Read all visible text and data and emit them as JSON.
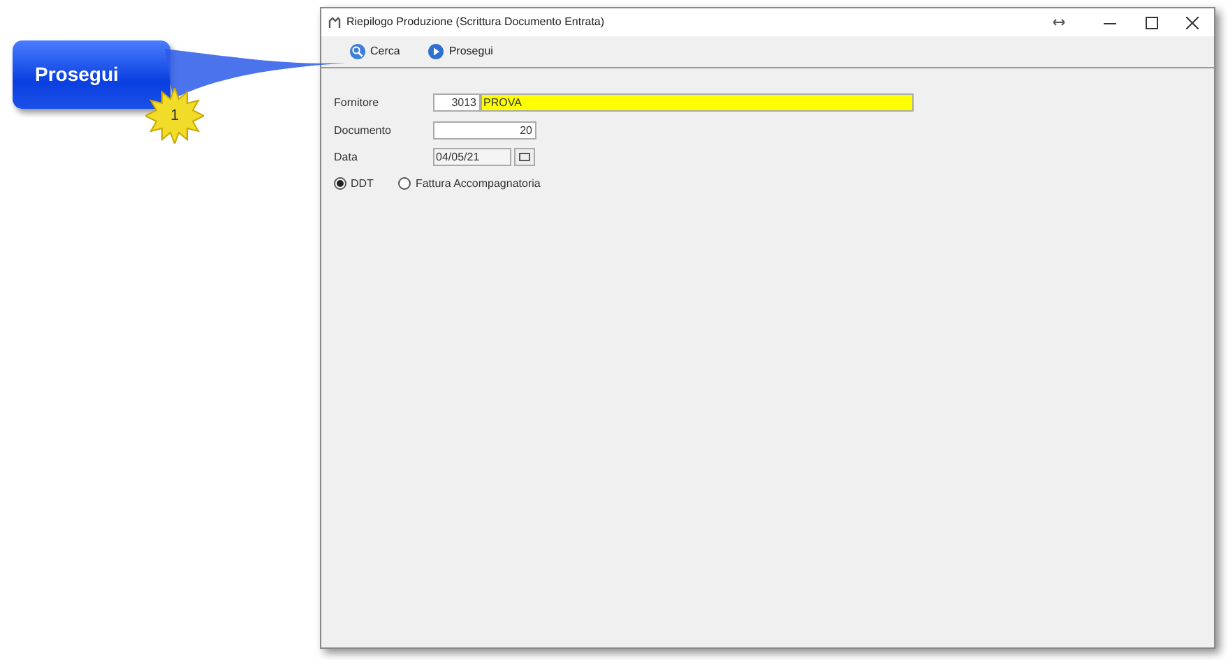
{
  "callout": {
    "label": "Prosegui",
    "number": "1"
  },
  "window": {
    "title": "Riepilogo Produzione (Scrittura Documento Entrata)"
  },
  "toolbar": [
    {
      "label": "Cerca",
      "kind": "search"
    },
    {
      "label": "Prosegui",
      "kind": "forward"
    }
  ],
  "form": {
    "fornitore": {
      "label": "Fornitore",
      "code": "3013",
      "name": "PROVA",
      "highlighted": true
    },
    "documento": {
      "label": "Documento",
      "value": "20"
    },
    "data": {
      "label": "Data",
      "value": "04/05/21"
    }
  },
  "radios": [
    {
      "label": "DDT",
      "selected": true
    },
    {
      "label": "Fattura Accompagnatoria",
      "selected": false
    }
  ]
}
